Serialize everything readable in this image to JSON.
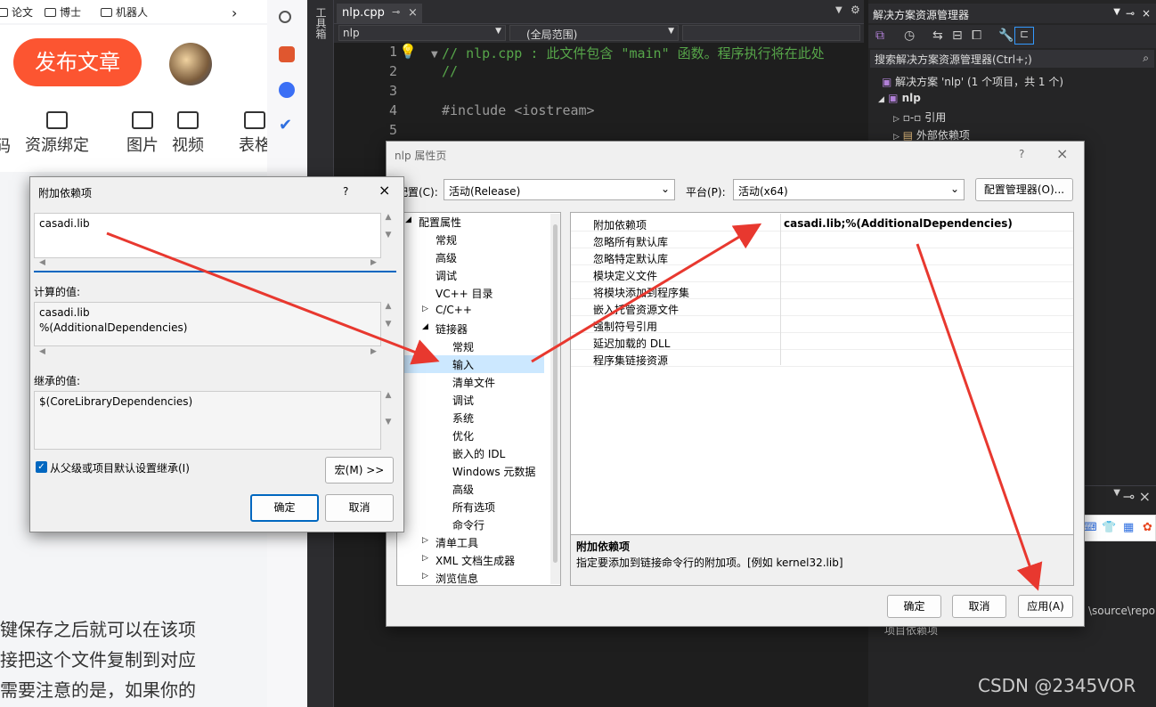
{
  "browser": {
    "bookmarks": [
      "论文",
      "博士",
      "机器人"
    ],
    "publish_button": "发布文章",
    "toolbar_items": [
      "码",
      "资源绑定",
      "图片",
      "视频",
      "表格"
    ],
    "article_lines": [
      "键保存之后就可以在该项",
      "接把这个文件复制到对应",
      "需要注意的是，如果你的"
    ]
  },
  "vs": {
    "toolbox_label": "工具箱",
    "tab_label": "nlp.cpp",
    "nav_project": "nlp",
    "nav_scope": "(全局范围)",
    "code_lines": [
      {
        "n": "1",
        "text": "// nlp.cpp : 此文件包含 \"main\" 函数。程序执行将在此处"
      },
      {
        "n": "2",
        "text": "//"
      },
      {
        "n": "3",
        "text": ""
      },
      {
        "n": "4",
        "text": "#include <iostream>"
      },
      {
        "n": "5",
        "text": ""
      }
    ],
    "solution_explorer": {
      "title": "解决方案资源管理器",
      "search_placeholder": "搜索解决方案资源管理器(Ctrl+;)",
      "solution": "解决方案 'nlp' (1 个项目，共 1 个)",
      "project": "nlp",
      "items": [
        "引用",
        "外部依赖项"
      ],
      "path_fragment": "\\source\\repo",
      "lower_label": "项目依赖项"
    },
    "ime": {
      "label": "英"
    },
    "watermark": "CSDN @2345VOR"
  },
  "props_dialog": {
    "title": "nlp 属性页",
    "help": "?",
    "config_label": "配置(C):",
    "config_value": "活动(Release)",
    "platform_label": "平台(P):",
    "platform_value": "活动(x64)",
    "config_manager": "配置管理器(O)...",
    "tree": [
      {
        "label": "配置属性",
        "level": 0,
        "exp": "◢"
      },
      {
        "label": "常规",
        "level": 1,
        "exp": ""
      },
      {
        "label": "高级",
        "level": 1,
        "exp": ""
      },
      {
        "label": "调试",
        "level": 1,
        "exp": ""
      },
      {
        "label": "VC++ 目录",
        "level": 1,
        "exp": ""
      },
      {
        "label": "C/C++",
        "level": 1,
        "exp": "▷"
      },
      {
        "label": "链接器",
        "level": 1,
        "exp": "◢"
      },
      {
        "label": "常规",
        "level": 2,
        "exp": ""
      },
      {
        "label": "输入",
        "level": 2,
        "exp": "",
        "selected": true
      },
      {
        "label": "清单文件",
        "level": 2,
        "exp": ""
      },
      {
        "label": "调试",
        "level": 2,
        "exp": ""
      },
      {
        "label": "系统",
        "level": 2,
        "exp": ""
      },
      {
        "label": "优化",
        "level": 2,
        "exp": ""
      },
      {
        "label": "嵌入的 IDL",
        "level": 2,
        "exp": ""
      },
      {
        "label": "Windows 元数据",
        "level": 2,
        "exp": ""
      },
      {
        "label": "高级",
        "level": 2,
        "exp": ""
      },
      {
        "label": "所有选项",
        "level": 2,
        "exp": ""
      },
      {
        "label": "命令行",
        "level": 2,
        "exp": ""
      },
      {
        "label": "清单工具",
        "level": 1,
        "exp": "▷"
      },
      {
        "label": "XML 文档生成器",
        "level": 1,
        "exp": "▷"
      },
      {
        "label": "浏览信息",
        "level": 1,
        "exp": "▷"
      }
    ],
    "grid": [
      {
        "key": "附加依赖项",
        "value": "casadi.lib;%(AdditionalDependencies)"
      },
      {
        "key": "忽略所有默认库",
        "value": ""
      },
      {
        "key": "忽略特定默认库",
        "value": ""
      },
      {
        "key": "模块定义文件",
        "value": ""
      },
      {
        "key": "将模块添加到程序集",
        "value": ""
      },
      {
        "key": "嵌入托管资源文件",
        "value": ""
      },
      {
        "key": "强制符号引用",
        "value": ""
      },
      {
        "key": "延迟加载的 DLL",
        "value": ""
      },
      {
        "key": "程序集链接资源",
        "value": ""
      }
    ],
    "desc_title": "附加依赖项",
    "desc_text": "指定要添加到链接命令行的附加项。[例如 kernel32.lib]",
    "ok": "确定",
    "cancel": "取消",
    "apply": "应用(A)"
  },
  "dep_dialog": {
    "title": "附加依赖项",
    "help": "?",
    "input_value": "casadi.lib",
    "computed_label": "计算的值:",
    "computed_lines": [
      "casadi.lib",
      "%(AdditionalDependencies)"
    ],
    "inherited_label": "继承的值:",
    "inherited_value": "$(CoreLibraryDependencies)",
    "inherit_checkbox": "从父级或项目默认设置继承(I)",
    "inherit_checked": true,
    "macro_button": "宏(M) >>",
    "ok": "确定",
    "cancel": "取消"
  },
  "colors": {
    "arrow": "#e8382f",
    "publish": "#fc5531",
    "selection": "#cce8ff",
    "checkbox": "#0067c0"
  }
}
